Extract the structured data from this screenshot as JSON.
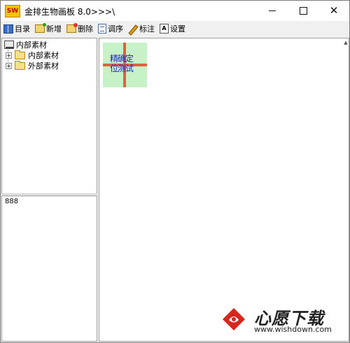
{
  "window": {
    "icon_text": "SW",
    "title": "金排生物画板 8.0>>>\\"
  },
  "toolbar": {
    "items": [
      {
        "label": "目录",
        "icon": "catalog-icon"
      },
      {
        "label": "新增",
        "icon": "add-icon"
      },
      {
        "label": "删除",
        "icon": "delete-icon"
      },
      {
        "label": "调序",
        "icon": "sort-icon"
      },
      {
        "label": "标注",
        "icon": "pencil-icon"
      },
      {
        "label": "设置",
        "icon": "settings-icon"
      }
    ]
  },
  "tree": {
    "root": "内部素材",
    "children": [
      "内部素材",
      "外部素材"
    ]
  },
  "info": {
    "text": "888"
  },
  "canvas": {
    "thumbnail": {
      "line1": "精确定",
      "line2": "位测试"
    }
  },
  "watermark": {
    "name": "心愿下载",
    "url": "www.wishdown.com"
  }
}
